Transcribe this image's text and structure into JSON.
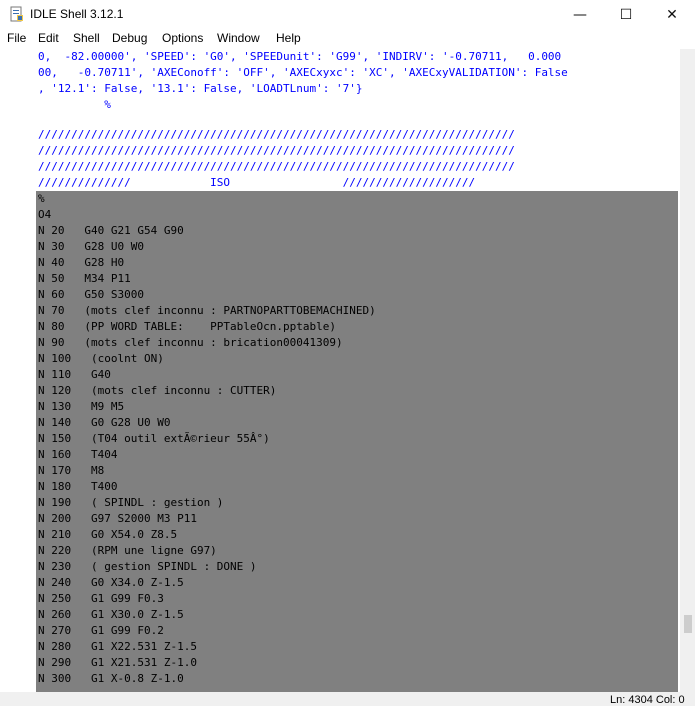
{
  "window": {
    "title": "IDLE Shell 3.12.1",
    "minimize_glyph": "—",
    "maximize_glyph": "☐",
    "close_glyph": "✕"
  },
  "menu": [
    "File",
    "Edit",
    "Shell",
    "Debug",
    "Options",
    "Window",
    "Help"
  ],
  "output_lines": [
    "0,  -82.00000', 'SPEED': 'G0', 'SPEEDunit': 'G99', 'INDIRV': '-0.70711,   0.000",
    "00,   -0.70711', 'AXEConoff': 'OFF', 'AXECxyxc': 'XC', 'AXECxyVALIDATION': False",
    ", '12.1': False, '13.1': False, 'LOADTLnum': '7'}",
    "          %",
    "",
    "////////////////////////////////////////////////////////////////////////",
    "////////////////////////////////////////////////////////////////////////",
    "////////////////////////////////////////////////////////////////////////",
    "//////////////            ISO                 ////////////////////"
  ],
  "iso_lines": [
    "%",
    "O4",
    "N 20   G40 G21 G54 G90",
    "N 30   G28 U0 W0",
    "N 40   G28 H0",
    "N 50   M34 P11",
    "N 60   G50 S3000",
    "N 70   (mots clef inconnu : PARTNOPARTTOBEMACHINED)",
    "N 80   (PP WORD TABLE:    PPTableOcn.pptable)",
    "N 90   (mots clef inconnu : brication00041309)",
    "N 100   (coolnt ON)",
    "N 110   G40",
    "N 120   (mots clef inconnu : CUTTER)",
    "N 130   M9 M5",
    "N 140   G0 G28 U0 W0",
    "N 150   (T04 outil extÃ©rieur 55Â°)",
    "N 160   T404",
    "N 170   M8",
    "N 180   T400",
    "N 190   ( SPINDL : gestion )",
    "N 200   G97 S2000 M3 P11",
    "N 210   G0 X54.0 Z8.5",
    "N 220   (RPM une ligne G97)",
    "N 230   ( gestion SPINDL : DONE )",
    "N 240   G0 X34.0 Z-1.5",
    "N 250   G1 G99 F0.3",
    "N 260   G1 X30.0 Z-1.5",
    "N 270   G1 G99 F0.2",
    "N 280   G1 X22.531 Z-1.5",
    "N 290   G1 X21.531 Z-1.0",
    "N 300   G1 X-0.8 Z-1.0"
  ],
  "status": "Ln: 4304   Col: 0",
  "colors": {
    "output_text": "#0000ff",
    "selection": "#808080",
    "normal_text": "#000000"
  }
}
